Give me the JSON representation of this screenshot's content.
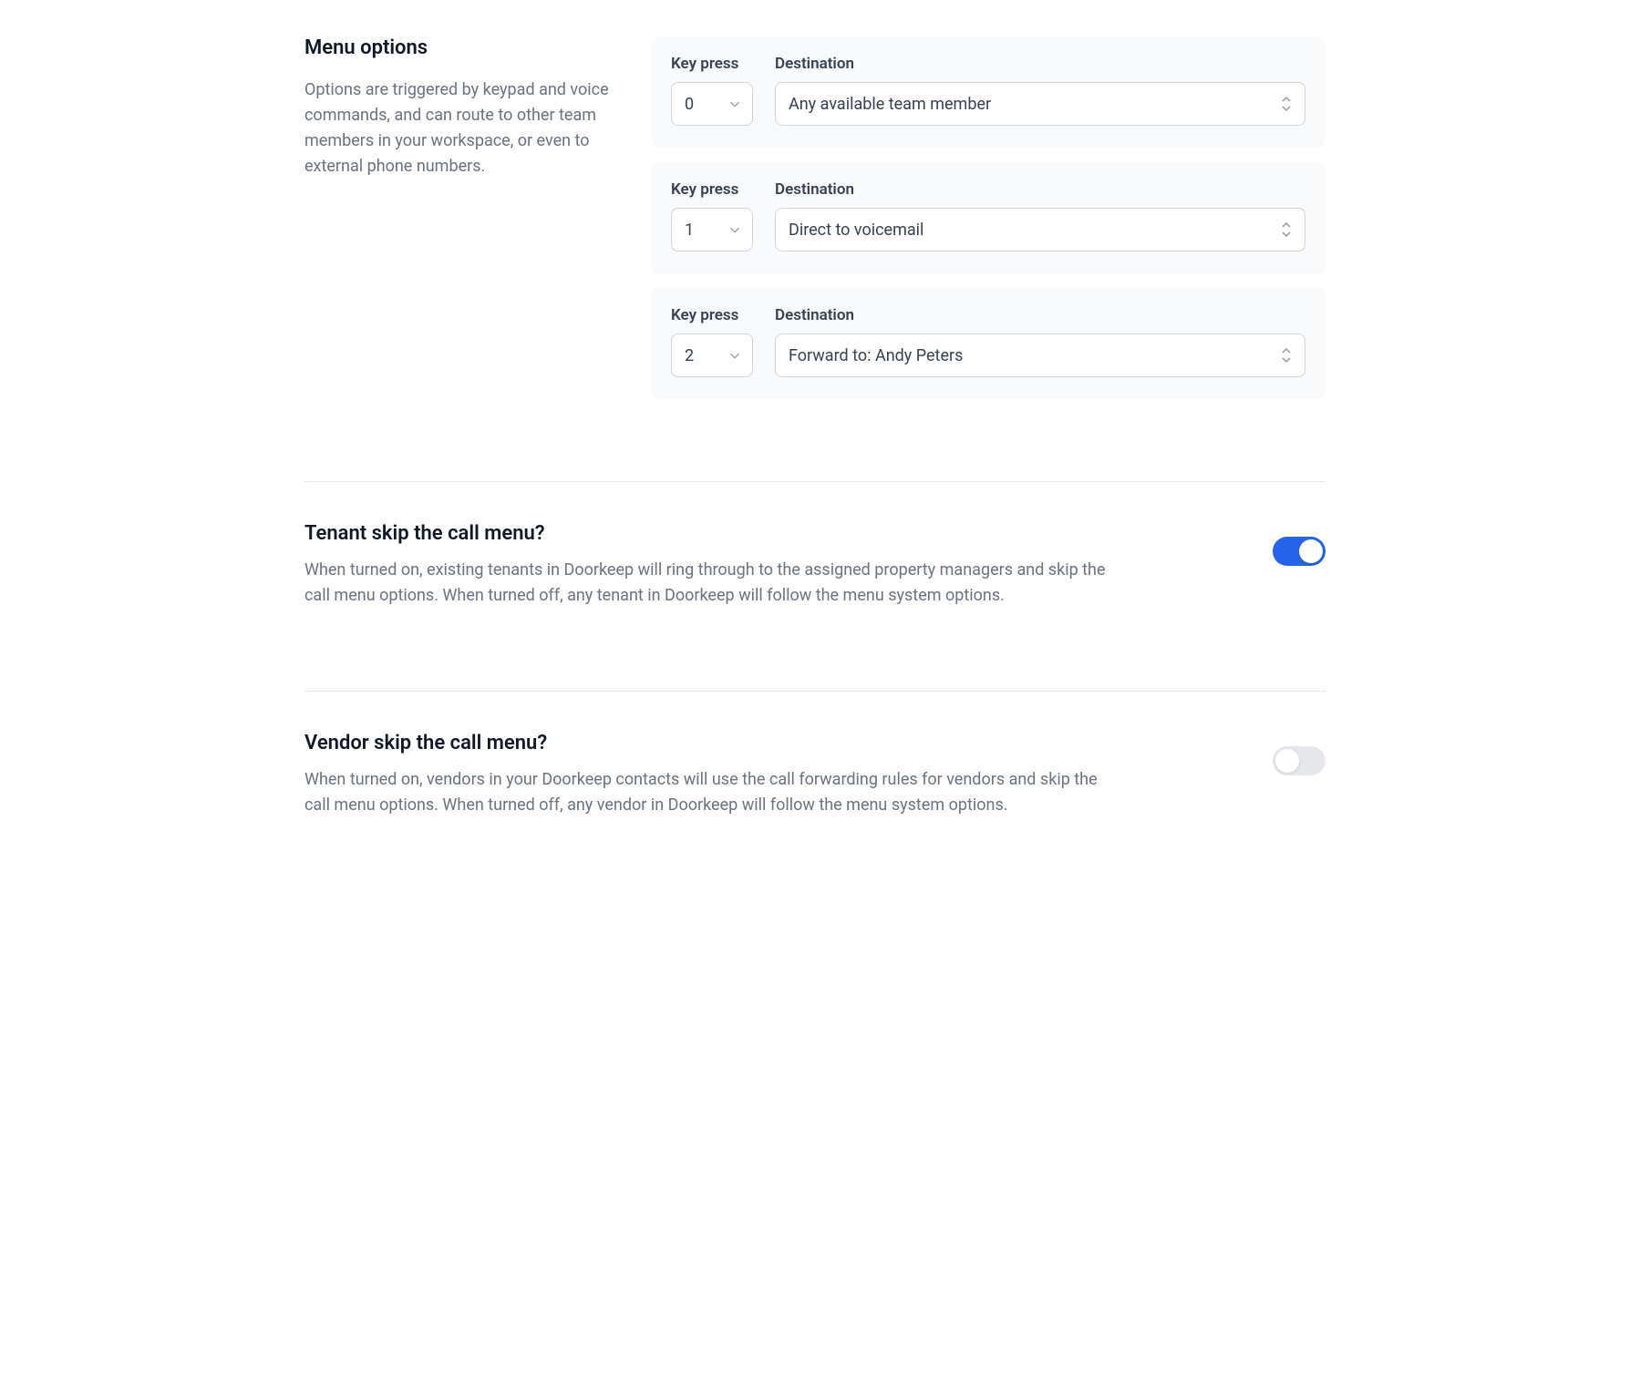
{
  "menu_options": {
    "title": "Menu options",
    "description": "Options are triggered by keypad and voice commands, and can route to other team members in your workspace, or even to external phone numbers.",
    "labels": {
      "key_press": "Key press",
      "destination": "Destination"
    },
    "rows": [
      {
        "key": "0",
        "destination": "Any available team member"
      },
      {
        "key": "1",
        "destination": "Direct to voicemail"
      },
      {
        "key": "2",
        "destination": "Forward to: Andy Peters"
      }
    ]
  },
  "tenant_skip": {
    "title": "Tenant skip the call menu?",
    "description": "When turned on, existing tenants in Doorkeep will ring through to the assigned property managers and skip the call menu options. When turned off, any tenant in Doorkeep will follow the menu system options.",
    "enabled": true
  },
  "vendor_skip": {
    "title": "Vendor skip the call menu?",
    "description": "When turned on, vendors in your Doorkeep contacts will use the call forwarding rules for vendors and skip the call menu options. When turned off, any vendor in Doorkeep will follow the menu system options.",
    "enabled": false
  }
}
